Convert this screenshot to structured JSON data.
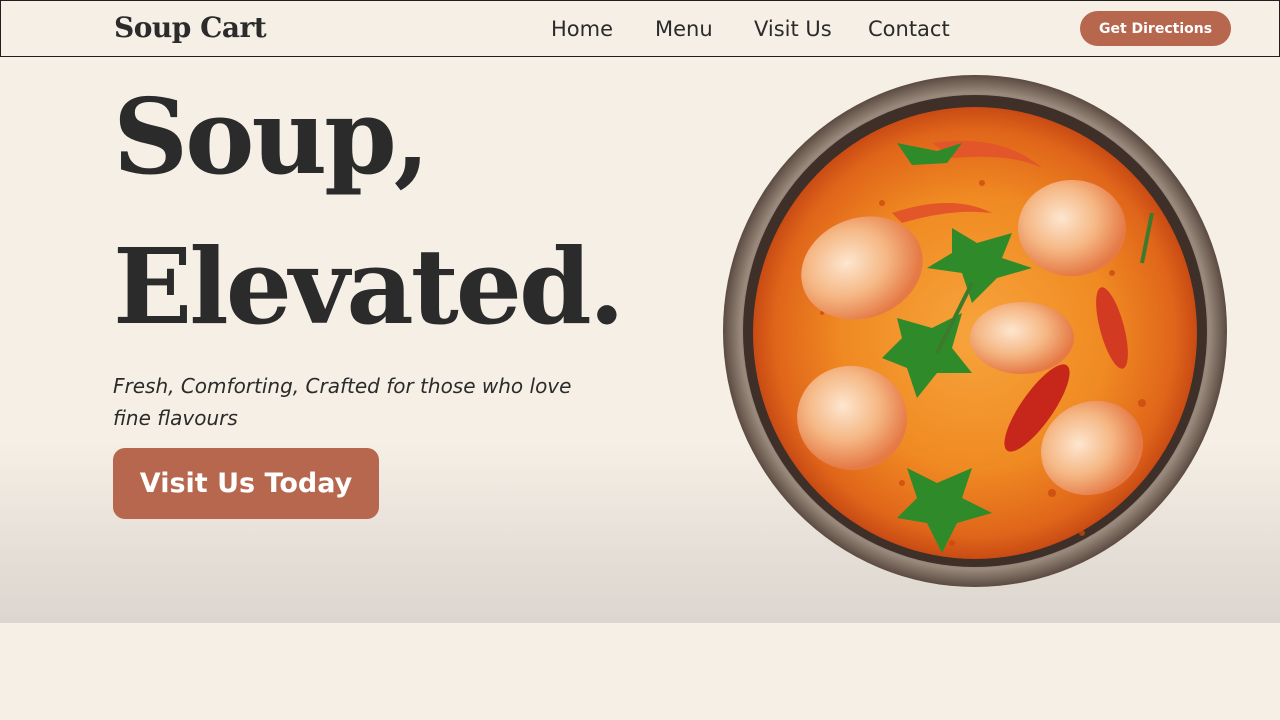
{
  "nav": {
    "logo": "Soup Cart",
    "links": [
      "Home",
      "Menu",
      "Visit Us",
      "Contact"
    ],
    "cta": "Get Directions"
  },
  "hero": {
    "headline_line1": "Soup,",
    "headline_line2": "Elevated.",
    "tagline": "Fresh, Comforting, Crafted for those who love fine flavours",
    "cta": "Visit Us Today",
    "image": "shrimp-soup-bowl"
  },
  "colors": {
    "background": "#f5efe6",
    "accent": "#b7674d",
    "text": "#2b2b2b"
  }
}
